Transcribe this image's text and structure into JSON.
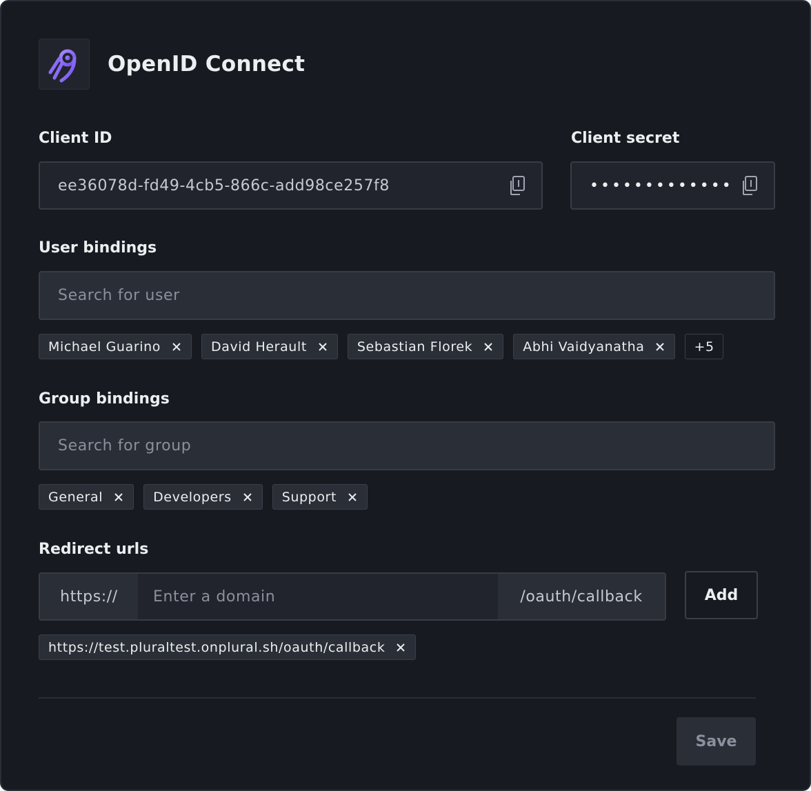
{
  "header": {
    "title": "OpenID Connect",
    "logo_icon": "plural-logo-icon"
  },
  "client_id": {
    "label": "Client ID",
    "value": "ee36078d-fd49-4cb5-866c-add98ce257f8",
    "icon": "copy-icon"
  },
  "client_secret": {
    "label": "Client secret",
    "value": "•••••••••••••",
    "icon": "copy-icon"
  },
  "user_bindings": {
    "label": "User bindings",
    "placeholder": "Search for user",
    "chips": [
      "Michael Guarino",
      "David Herault",
      "Sebastian Florek",
      "Abhi Vaidyanatha"
    ],
    "more": "+5"
  },
  "group_bindings": {
    "label": "Group bindings",
    "placeholder": "Search for group",
    "chips": [
      "General",
      "Developers",
      "Support"
    ]
  },
  "redirect_urls": {
    "label": "Redirect urls",
    "prefix": "https://",
    "placeholder": "Enter a domain",
    "suffix": "/oauth/callback",
    "add_label": "Add",
    "chips": [
      "https://test.pluraltest.onplural.sh/oauth/callback"
    ]
  },
  "footer": {
    "save_label": "Save"
  },
  "colors": {
    "background": "#171a21",
    "logo_accent": "#8b6cf6",
    "field_bg": "#21242c",
    "chip_bg": "#2a2e37"
  }
}
